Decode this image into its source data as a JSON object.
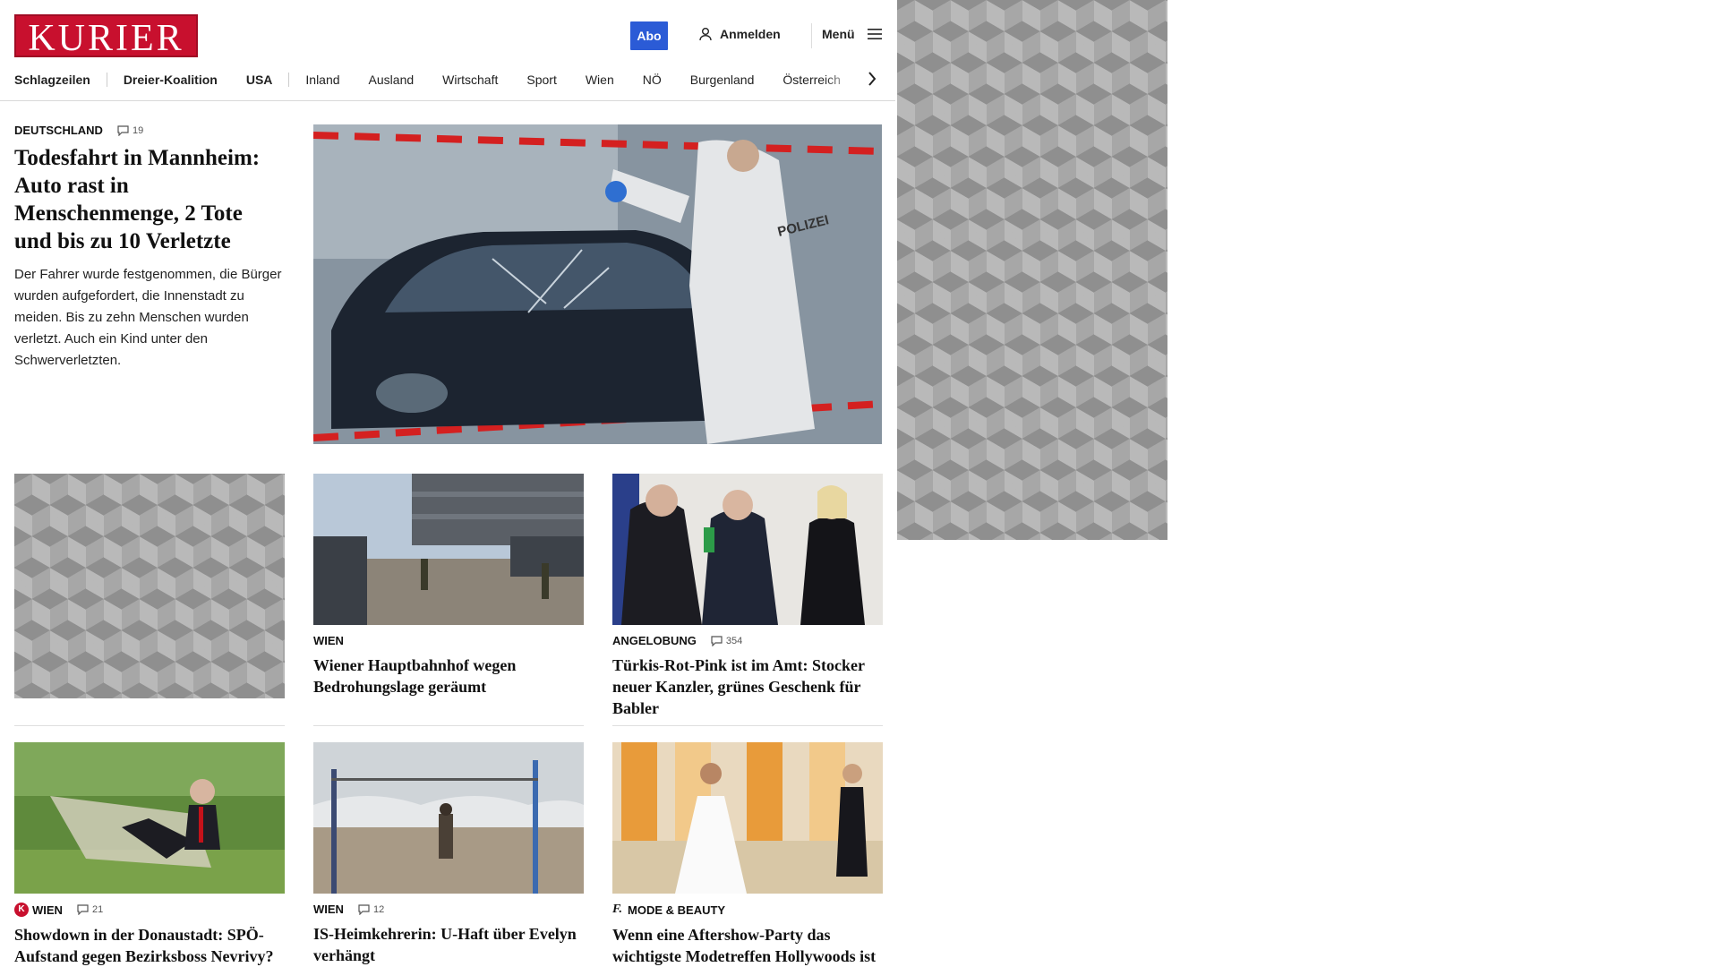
{
  "header": {
    "logo_text": "KURIER",
    "abo_label": "Abo",
    "login_label": "Anmelden",
    "menu_label": "Menü",
    "brand_color": "#c8102e",
    "accent_color": "#2b5bd6"
  },
  "nav": {
    "items": [
      {
        "label": "Schlagzeilen",
        "bold": true
      },
      {
        "label": "Dreier-Koalition",
        "bold": true
      },
      {
        "label": "USA",
        "bold": true
      },
      {
        "label": "Inland",
        "bold": false
      },
      {
        "label": "Ausland",
        "bold": false
      },
      {
        "label": "Wirtschaft",
        "bold": false
      },
      {
        "label": "Sport",
        "bold": false
      },
      {
        "label": "Wien",
        "bold": false
      },
      {
        "label": "NÖ",
        "bold": false
      },
      {
        "label": "Burgenland",
        "bold": false
      },
      {
        "label": "Österreich",
        "bold": false
      }
    ]
  },
  "lead": {
    "kicker": "DEUTSCHLAND",
    "comments": "19",
    "title": "Todesfahrt in Mannheim: Auto rast in Menschenmenge, 2 Tote und bis zu 10 Verletzte",
    "subtitle": "Der Fahrer wurde festgenommen, die Bürger wurden aufgefordert, die Innenstadt zu meiden. Bis zu zehn Menschen wurden verletzt. Auch ein Kind unter den Schwerverletzten.",
    "image_text": "POLIZEI"
  },
  "cards": [
    {
      "kicker": "WIEN",
      "comments": "",
      "title": "Wiener Hauptbahnhof wegen Bedrohungslage geräumt"
    },
    {
      "kicker": "ANGELOBUNG",
      "comments": "354",
      "title": "Türkis-Rot-Pink ist im Amt: Stocker neuer Kanzler, grünes Geschenk für Babler"
    },
    {
      "kicker": "WIEN",
      "comments": "21",
      "title": "Showdown in der Donaustadt: SPÖ-Aufstand gegen Bezirksboss Nevrivy?"
    },
    {
      "kicker": "WIEN",
      "comments": "12",
      "title": "IS-Heimkehrerin: U-Haft über Evelyn verhängt"
    },
    {
      "kicker": "MODE & BEAUTY",
      "comments": "",
      "title": "Wenn eine Aftershow-Party das wichtigste Modetreffen Hollywoods ist"
    }
  ],
  "icons": {
    "user": "user-icon",
    "menu": "hamburger-menu-icon",
    "comment": "comment-icon",
    "arrow": "chevron-right-icon"
  }
}
